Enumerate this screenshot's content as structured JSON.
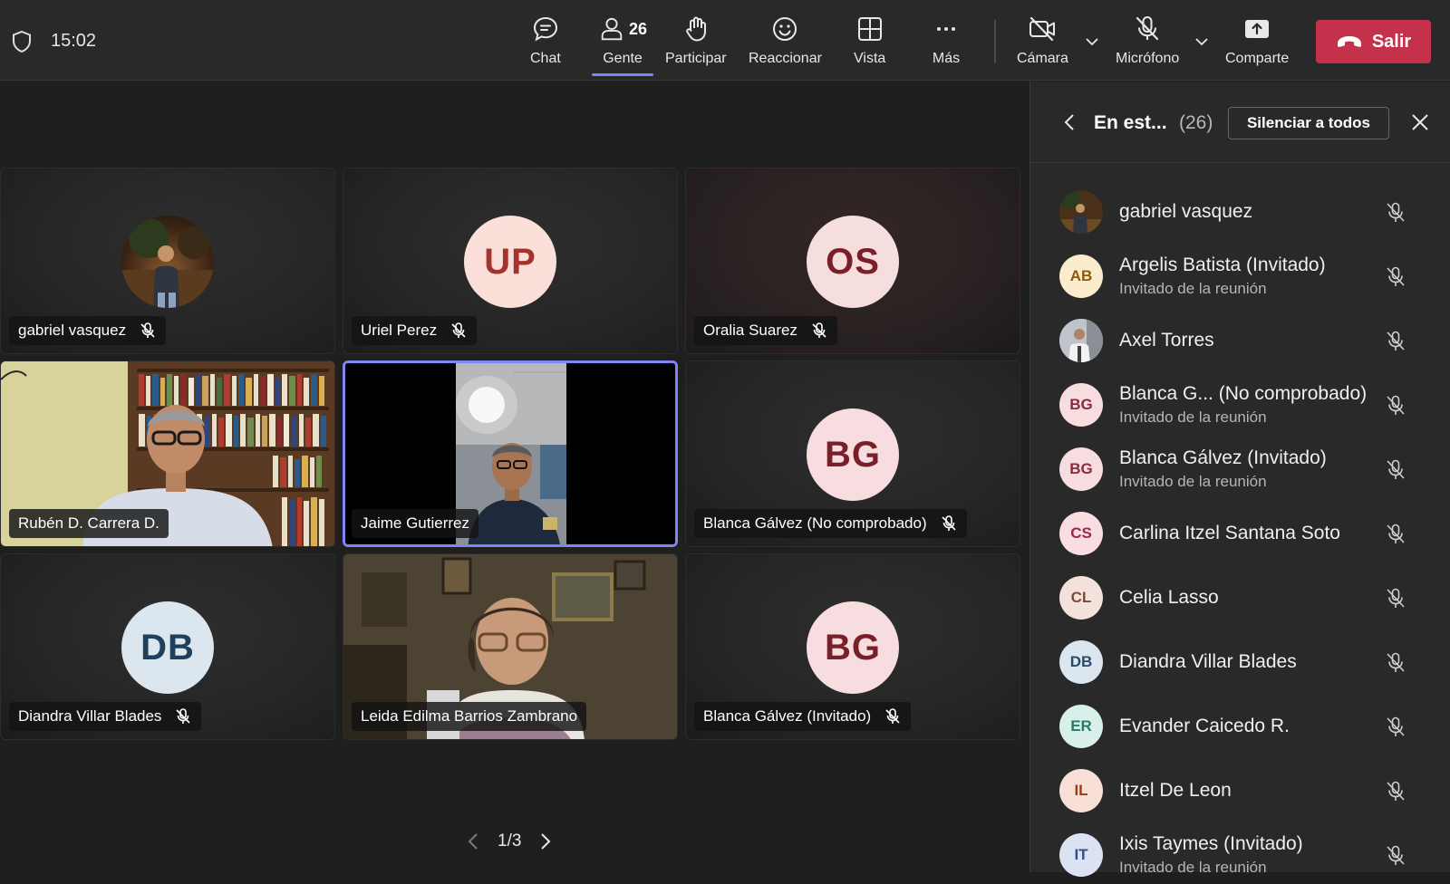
{
  "topbar": {
    "time": "15:02",
    "tools": {
      "chat": "Chat",
      "people": "Gente",
      "people_count": "26",
      "raise": "Participar",
      "react": "Reaccionar",
      "view": "Vista",
      "more": "Más",
      "camera": "Cámara",
      "mic": "Micrófono",
      "share": "Comparte"
    },
    "leave_label": "Salir"
  },
  "tiles": [
    {
      "name": "gabriel vasquez",
      "initials": "",
      "muted": true
    },
    {
      "name": "Uriel Perez",
      "initials": "UP",
      "muted": true
    },
    {
      "name": "Oralia Suarez",
      "initials": "OS",
      "muted": true
    },
    {
      "name": "Rubén D. Carrera D.",
      "initials": "",
      "muted": false
    },
    {
      "name": "Jaime Gutierrez",
      "initials": "",
      "muted": false
    },
    {
      "name": "Blanca Gálvez (No comprobado)",
      "initials": "BG",
      "muted": true
    },
    {
      "name": "Diandra Villar Blades",
      "initials": "DB",
      "muted": true
    },
    {
      "name": "Leida Edilma Barrios Zambrano",
      "initials": "",
      "muted": false
    },
    {
      "name": "Blanca Gálvez (Invitado)",
      "initials": "BG",
      "muted": true
    }
  ],
  "pager": {
    "label": "1/3"
  },
  "panel": {
    "title": "En est...",
    "count": "(26)",
    "mute_all": "Silenciar a todos",
    "participants": [
      {
        "name": "gabriel vasquez",
        "sub": "",
        "initials": ""
      },
      {
        "name": "Argelis Batista (Invitado)",
        "sub": "Invitado de la reunión",
        "initials": "AB"
      },
      {
        "name": "Axel Torres",
        "sub": "",
        "initials": ""
      },
      {
        "name": "Blanca G...  (No comprobado)",
        "sub": "Invitado de la reunión",
        "initials": "BG"
      },
      {
        "name": "Blanca Gálvez (Invitado)",
        "sub": "Invitado de la reunión",
        "initials": "BG"
      },
      {
        "name": "Carlina Itzel Santana Soto",
        "sub": "",
        "initials": "CS"
      },
      {
        "name": "Celia Lasso",
        "sub": "",
        "initials": "CL"
      },
      {
        "name": "Diandra Villar Blades",
        "sub": "",
        "initials": "DB"
      },
      {
        "name": "Evander Caicedo R.",
        "sub": "",
        "initials": "ER"
      },
      {
        "name": "Itzel De Leon",
        "sub": "",
        "initials": "IL"
      },
      {
        "name": "Ixis Taymes (Invitado)",
        "sub": "Invitado de la reunión",
        "initials": "IT"
      }
    ]
  },
  "colors": {
    "accent": "#7f85f5",
    "leave": "#c4314b",
    "avatar_pink": "#f9dede",
    "avatar_blue": "#dbe6f0"
  }
}
